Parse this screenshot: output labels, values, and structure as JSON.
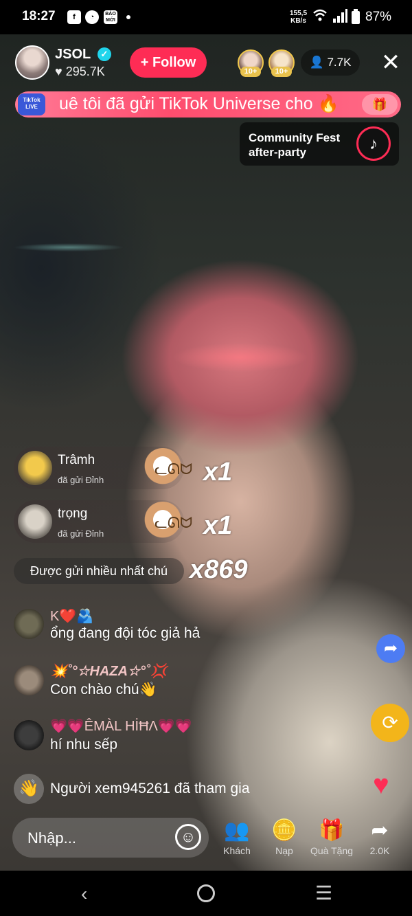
{
  "status_bar": {
    "time": "18:27",
    "network_speed_value": "155,5",
    "network_speed_unit": "KB/s",
    "battery": "87%",
    "icons": [
      "facebook-icon",
      "app-icon",
      "baomoi-icon",
      "notification-dot",
      "wifi-icon",
      "signal-icon",
      "battery-icon"
    ],
    "baomoi_label": "BÁO MỚI"
  },
  "host": {
    "name": "JSOL",
    "likes": "295.7K",
    "follow_label": "Follow"
  },
  "viewers": {
    "count": "7.7K",
    "top": [
      {
        "badge": "10+"
      },
      {
        "badge": "10+"
      }
    ]
  },
  "banner": {
    "logo_label": "TikTok LIVE",
    "text": "uê tôi đã gửi TikTok Universe cho 🔥"
  },
  "event": {
    "title_line1": "Community Fest",
    "title_line2": "after-party"
  },
  "gifts": [
    {
      "name": "Trâmh",
      "sub": "đã gửi Đỉnh",
      "combo": "x1"
    },
    {
      "name": "trọng",
      "sub": "đã gửi Đỉnh",
      "combo": "x1"
    }
  ],
  "top_gift": {
    "label": "Được gửi nhiều nhất chú",
    "combo": "x869"
  },
  "chat": [
    {
      "name": "K❤️🫂",
      "message": "ổng đang đội tóc giả hả"
    },
    {
      "name": "💥˚°☆HAZA☆°˚💢",
      "message": "Con chào chú👋"
    },
    {
      "name": "💗💗ÊΜÀL ΗİĦΛ💗💗",
      "message": "hí nhu sếp"
    }
  ],
  "join": {
    "message": "Người xem945261 đã tham gia"
  },
  "input": {
    "placeholder": "Nhập..."
  },
  "bottom_actions": [
    {
      "label": "Khách",
      "icon": "guests-icon"
    },
    {
      "label": "Nạp",
      "icon": "recharge-icon"
    },
    {
      "label": "Quà Tặng",
      "icon": "gift-icon"
    },
    {
      "label": "2.0K",
      "icon": "share-icon"
    }
  ],
  "colors": {
    "accent": "#fe2c55",
    "verified": "#20d5ec",
    "share_side": "#4d7cf3",
    "repost_side": "#f3b51a"
  }
}
